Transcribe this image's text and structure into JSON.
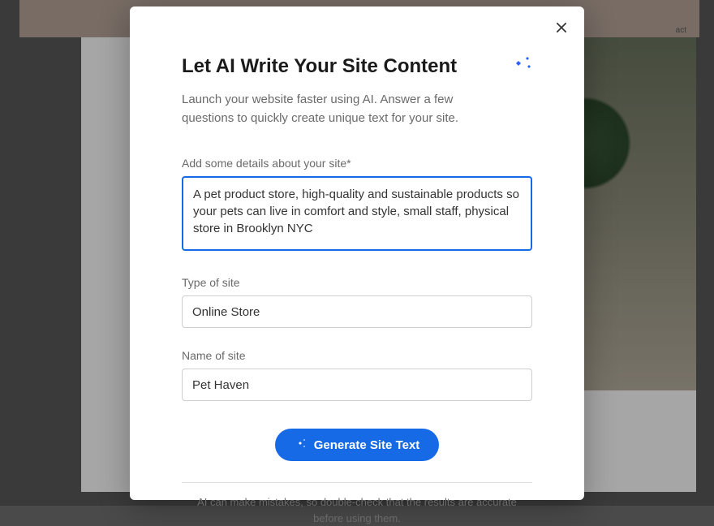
{
  "background": {
    "partial_label": "act"
  },
  "modal": {
    "title": "Let AI Write Your Site Content",
    "subtitle": "Launch your website faster using AI. Answer a few questions to quickly create unique text for your site.",
    "fields": {
      "details": {
        "label": "Add some details about your site*",
        "value": "A pet product store, high-quality and sustainable products so your pets can live in comfort and style, small staff, physical store in Brooklyn NYC"
      },
      "site_type": {
        "label": "Type of site",
        "value": "Online Store"
      },
      "site_name": {
        "label": "Name of site",
        "value": "Pet Haven"
      }
    },
    "generate_button": "Generate Site Text",
    "disclaimer": "AI can make mistakes, so double-check that the results are accurate before using them."
  }
}
